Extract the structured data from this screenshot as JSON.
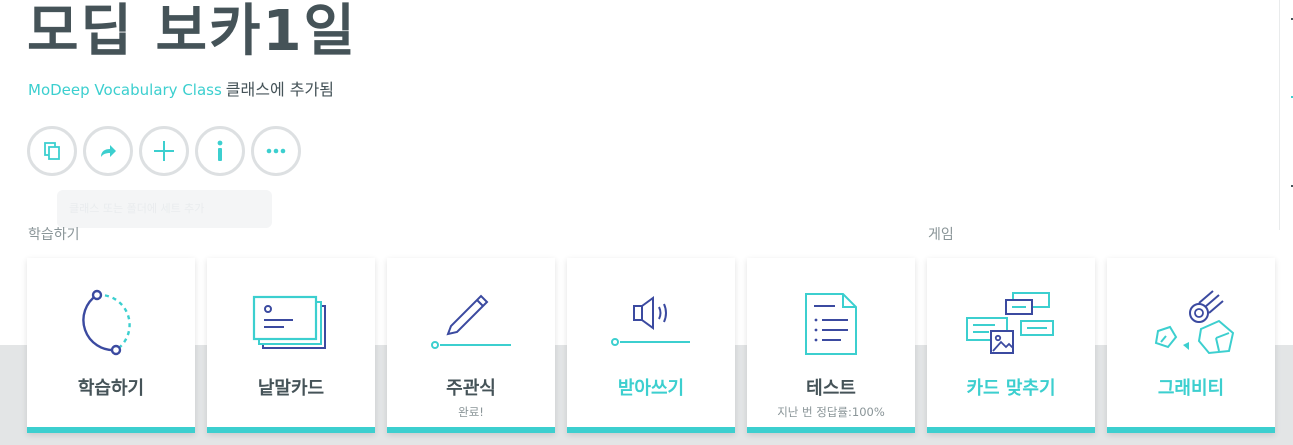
{
  "set": {
    "title": "모딥 보카1일",
    "class_link": "MoDeep Vocabulary Class",
    "class_added_text": "클래스에 추가됨"
  },
  "actions": [
    {
      "name": "copy-icon"
    },
    {
      "name": "share-icon"
    },
    {
      "name": "add-icon"
    },
    {
      "name": "info-icon"
    },
    {
      "name": "more-icon"
    }
  ],
  "tooltip": {
    "text": "클래스 또는 폴더에 세트 추가"
  },
  "sections": {
    "study_label": "학습하기",
    "games_label": "게임"
  },
  "modes": [
    {
      "label": "학습하기",
      "sub": "",
      "icon": "learn-icon"
    },
    {
      "label": "낱말카드",
      "sub": "",
      "icon": "flashcards-icon"
    },
    {
      "label": "주관식",
      "sub": "완료!",
      "icon": "write-icon"
    },
    {
      "label": "받아쓰기",
      "sub": "",
      "icon": "spell-icon"
    },
    {
      "label": "테스트",
      "sub": "지난 번 정답률:100%",
      "icon": "test-icon"
    },
    {
      "label": "카드 맞추기",
      "sub": "",
      "icon": "match-icon"
    },
    {
      "label": "그래비티",
      "sub": "",
      "icon": "gravity-icon"
    }
  ],
  "colors": {
    "accent": "#3ccfcf",
    "navy": "#3b4aa0",
    "text": "#455358",
    "muted": "#8a9598"
  }
}
